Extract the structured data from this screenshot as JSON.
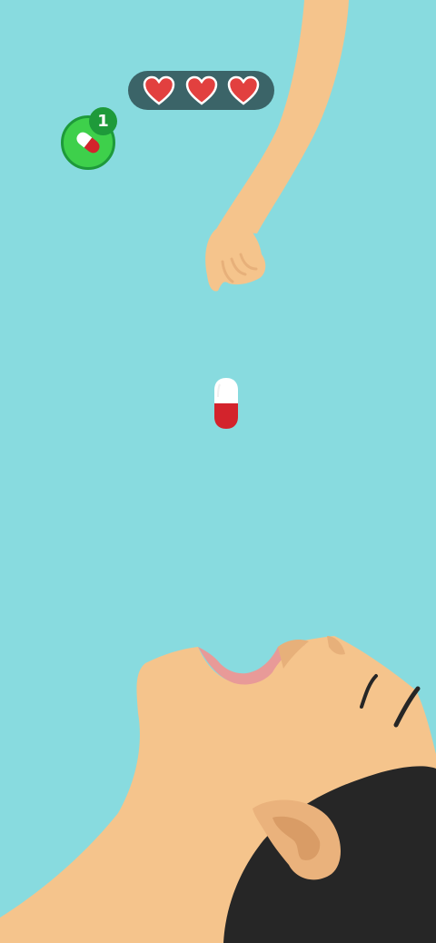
{
  "colors": {
    "sky": "#88dbdf",
    "skin": "#f5c48c",
    "skin_shadow": "#e7b07a",
    "hair": "#262626",
    "mouth_inner": "#e89a98",
    "hud_bar": "#3b6468",
    "heart_red": "#e2403f",
    "heart_outline": "#ffffff",
    "counter_green": "#3ed04b",
    "badge_green": "#1e9a3a",
    "pill_red": "#d3232c",
    "pill_white": "#ffffff"
  },
  "hud": {
    "lives": {
      "total": 3,
      "remaining": 3,
      "icon": "heart-icon"
    },
    "pill_counter": {
      "icon": "capsule-icon",
      "count": "1"
    }
  },
  "scene": {
    "falling_object": "capsule-pill",
    "hand": "closed-fist-hand",
    "patient": "open-mouth-face"
  }
}
